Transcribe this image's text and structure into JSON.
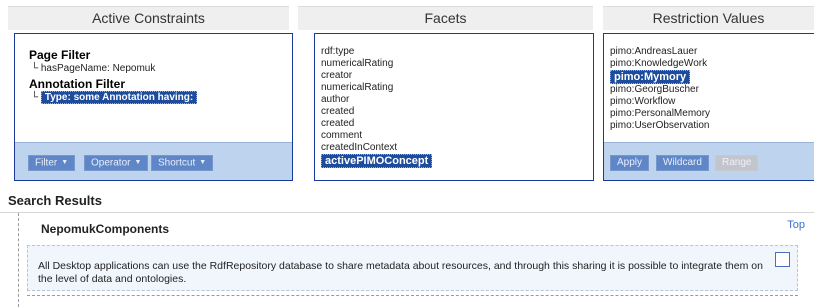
{
  "columns": {
    "constraints_title": "Active Constraints",
    "facets_title": "Facets",
    "restrictions_title": "Restriction Values"
  },
  "constraints": {
    "page_filter_title": "Page Filter",
    "page_filter_line": "└ hasPageName: Nepomuk",
    "annotation_filter_title": "Annotation Filter",
    "annotation_prefix": "└",
    "annotation_selected": "Type: some Annotation having:",
    "buttons": {
      "filter": "Filter",
      "operator": "Operator",
      "shortcut": "Shortcut"
    }
  },
  "facets": {
    "items": [
      "rdf:type",
      "numericalRating",
      "creator",
      "numericalRating",
      "author",
      "created",
      "created",
      "comment",
      "createdInContext"
    ],
    "selected": "activePIMOConcept"
  },
  "restrictions": {
    "items_before": [
      "pimo:AndreasLauer",
      "pimo:KnowledgeWork"
    ],
    "selected": "pimo:Mymory",
    "items_after": [
      "pimo:GeorgBuscher",
      "pimo:Workflow",
      "pimo:PersonalMemory",
      "pimo:UserObservation"
    ],
    "buttons": {
      "apply": "Apply",
      "wildcard": "Wildcard",
      "range": "Range"
    }
  },
  "results": {
    "title": "Search Results",
    "component_title": "NepomukComponents",
    "top_link": "Top",
    "description": "All Desktop applications can use the RdfRepository database to share metadata about resources, and through this sharing it is possible to integrate them on the level of data and ontologies."
  }
}
